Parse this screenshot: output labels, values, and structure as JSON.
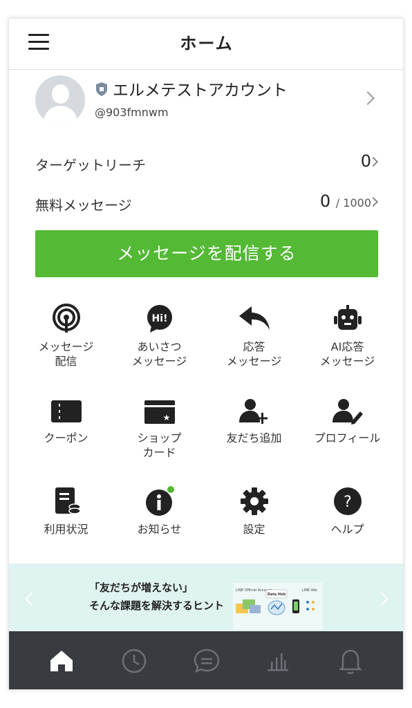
{
  "header": {
    "title": "ホーム",
    "menu_icon": "hamburger-menu-icon"
  },
  "account": {
    "name": "エルメテストアカウント",
    "id": "@903fmnwm",
    "badge_icon": "shield-icon"
  },
  "stats": [
    {
      "label": "ターゲットリーチ",
      "value": "0",
      "total": ""
    },
    {
      "label": "無料メッセージ",
      "value": "0",
      "total": "/ 1000"
    }
  ],
  "send_button": "メッセージを配信する",
  "menu": [
    {
      "label": "メッセージ\n配信",
      "icon": "broadcast-icon"
    },
    {
      "label": "あいさつ\nメッセージ",
      "icon": "greeting-bubble-icon",
      "icon_text": "Hi!"
    },
    {
      "label": "応答\nメッセージ",
      "icon": "reply-arrow-icon"
    },
    {
      "label": "AI応答\nメッセージ",
      "icon": "robot-icon"
    },
    {
      "label": "クーポン",
      "icon": "coupon-icon"
    },
    {
      "label": "ショップ\nカード",
      "icon": "shop-card-icon"
    },
    {
      "label": "友だち追加",
      "icon": "add-friend-icon"
    },
    {
      "label": "プロフィール",
      "icon": "profile-edit-icon"
    },
    {
      "label": "利用状況",
      "icon": "usage-report-icon"
    },
    {
      "label": "お知らせ",
      "icon": "info-icon"
    },
    {
      "label": "設定",
      "icon": "gear-icon"
    },
    {
      "label": "ヘルプ",
      "icon": "help-icon"
    }
  ],
  "banner": {
    "line1": "「友だちが増えない」",
    "line2": "そんな課題を解決するヒント",
    "image_labels": [
      "LINE Official Account",
      "Data Hub",
      "LINE Ads"
    ]
  },
  "tabbar": [
    "home-icon",
    "clock-icon",
    "chat-icon",
    "chart-icon",
    "bell-icon"
  ],
  "colors": {
    "accent": "#54b935",
    "tabbar_bg": "#383b40",
    "banner_bg": "#dff3f1",
    "notice_dot": "#54b935"
  }
}
